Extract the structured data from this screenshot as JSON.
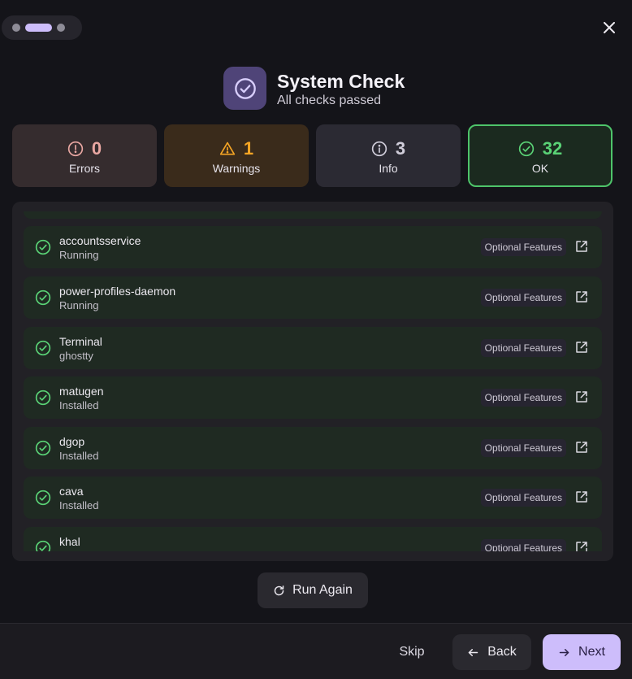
{
  "header": {
    "title": "System Check",
    "subtitle": "All checks passed"
  },
  "stats": {
    "errors": {
      "count": "0",
      "label": "Errors"
    },
    "warnings": {
      "count": "1",
      "label": "Warnings"
    },
    "info": {
      "count": "3",
      "label": "Info"
    },
    "ok": {
      "count": "32",
      "label": "OK"
    }
  },
  "items": [
    {
      "name": "accountsservice",
      "status": "Running",
      "category": "Optional Features"
    },
    {
      "name": "power-profiles-daemon",
      "status": "Running",
      "category": "Optional Features"
    },
    {
      "name": "Terminal",
      "status": "ghostty",
      "category": "Optional Features"
    },
    {
      "name": "matugen",
      "status": "Installed",
      "category": "Optional Features"
    },
    {
      "name": "dgop",
      "status": "Installed",
      "category": "Optional Features"
    },
    {
      "name": "cava",
      "status": "Installed",
      "category": "Optional Features"
    },
    {
      "name": "khal",
      "status": "",
      "category": "Optional Features"
    }
  ],
  "actions": {
    "run_again": "Run Again",
    "skip": "Skip",
    "back": "Back",
    "next": "Next"
  },
  "icons": {
    "header": "check-circle-icon",
    "errors": "alert-circle-icon",
    "warnings": "warning-triangle-icon",
    "info": "info-circle-icon",
    "ok": "check-circle-icon",
    "item_status": "check-circle-icon",
    "item_action": "external-link-icon",
    "run_again": "refresh-icon",
    "back": "arrow-left-icon",
    "next": "arrow-right-icon",
    "close": "close-icon"
  },
  "colors": {
    "accent": "#cdbdfb",
    "ok": "#5ad276",
    "warning": "#f5a524",
    "error": "#e9a7a2"
  }
}
